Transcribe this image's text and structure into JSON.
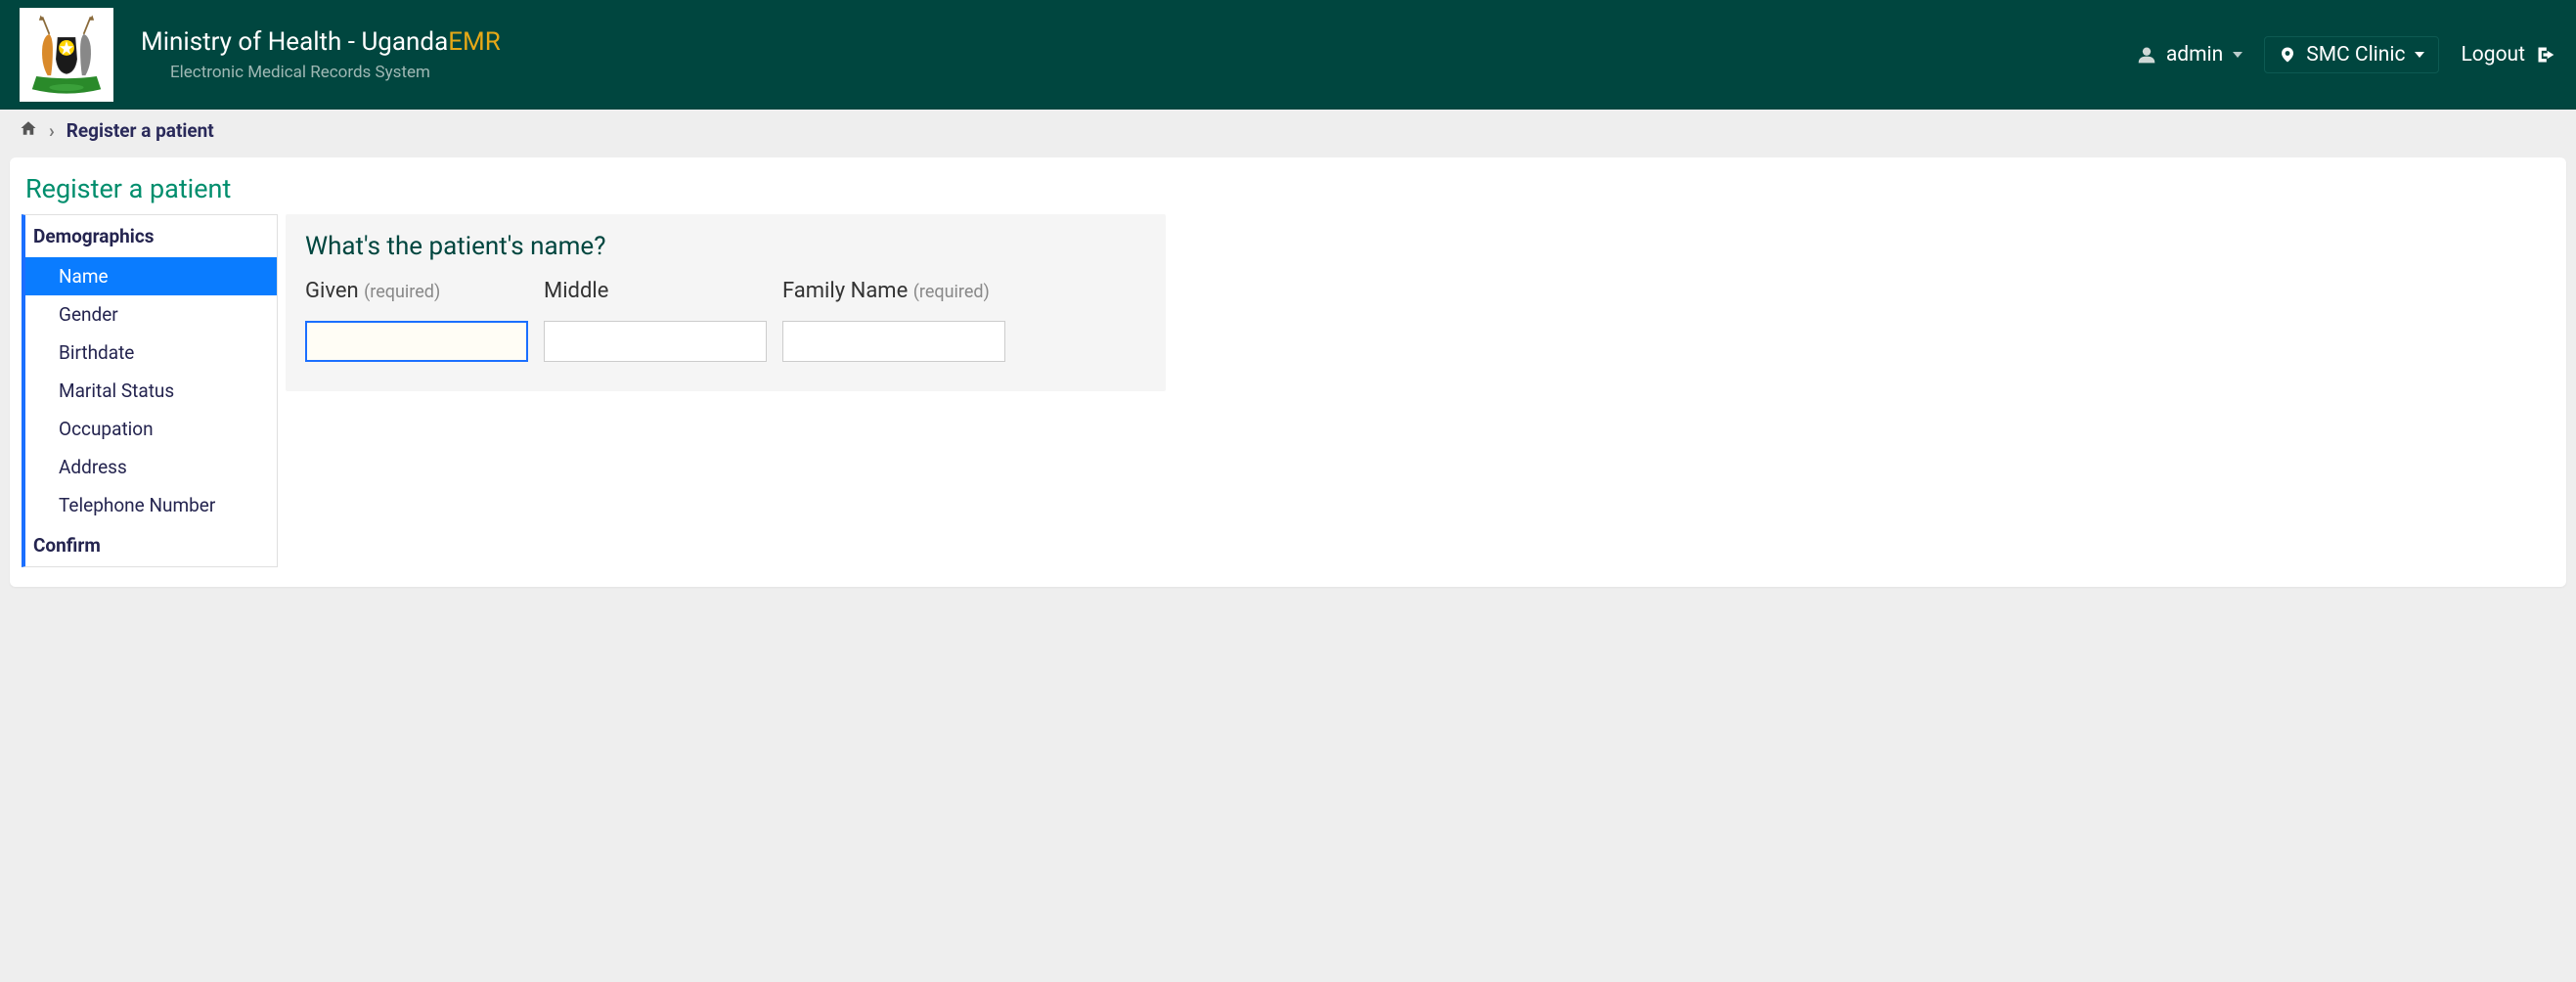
{
  "header": {
    "title_prefix": "Ministry of Health - Uganda",
    "title_suffix": "EMR",
    "subtitle": "Electronic Medical Records System",
    "user": "admin",
    "location": "SMC Clinic",
    "logout": "Logout"
  },
  "breadcrumb": {
    "current": "Register a patient"
  },
  "page": {
    "title": "Register a patient"
  },
  "sidebar": {
    "sections": [
      {
        "header": "Demographics"
      }
    ],
    "items": [
      {
        "label": "Name",
        "active": true
      },
      {
        "label": "Gender"
      },
      {
        "label": "Birthdate"
      },
      {
        "label": "Marital Status"
      },
      {
        "label": "Occupation"
      },
      {
        "label": "Address"
      },
      {
        "label": "Telephone Number"
      }
    ],
    "confirm": "Confirm"
  },
  "form": {
    "question": "What's the patient's name?",
    "fields": {
      "given": {
        "label": "Given",
        "req": "(required)",
        "value": ""
      },
      "middle": {
        "label": "Middle",
        "value": ""
      },
      "family": {
        "label": "Family Name",
        "req": "(required)",
        "value": ""
      }
    }
  }
}
